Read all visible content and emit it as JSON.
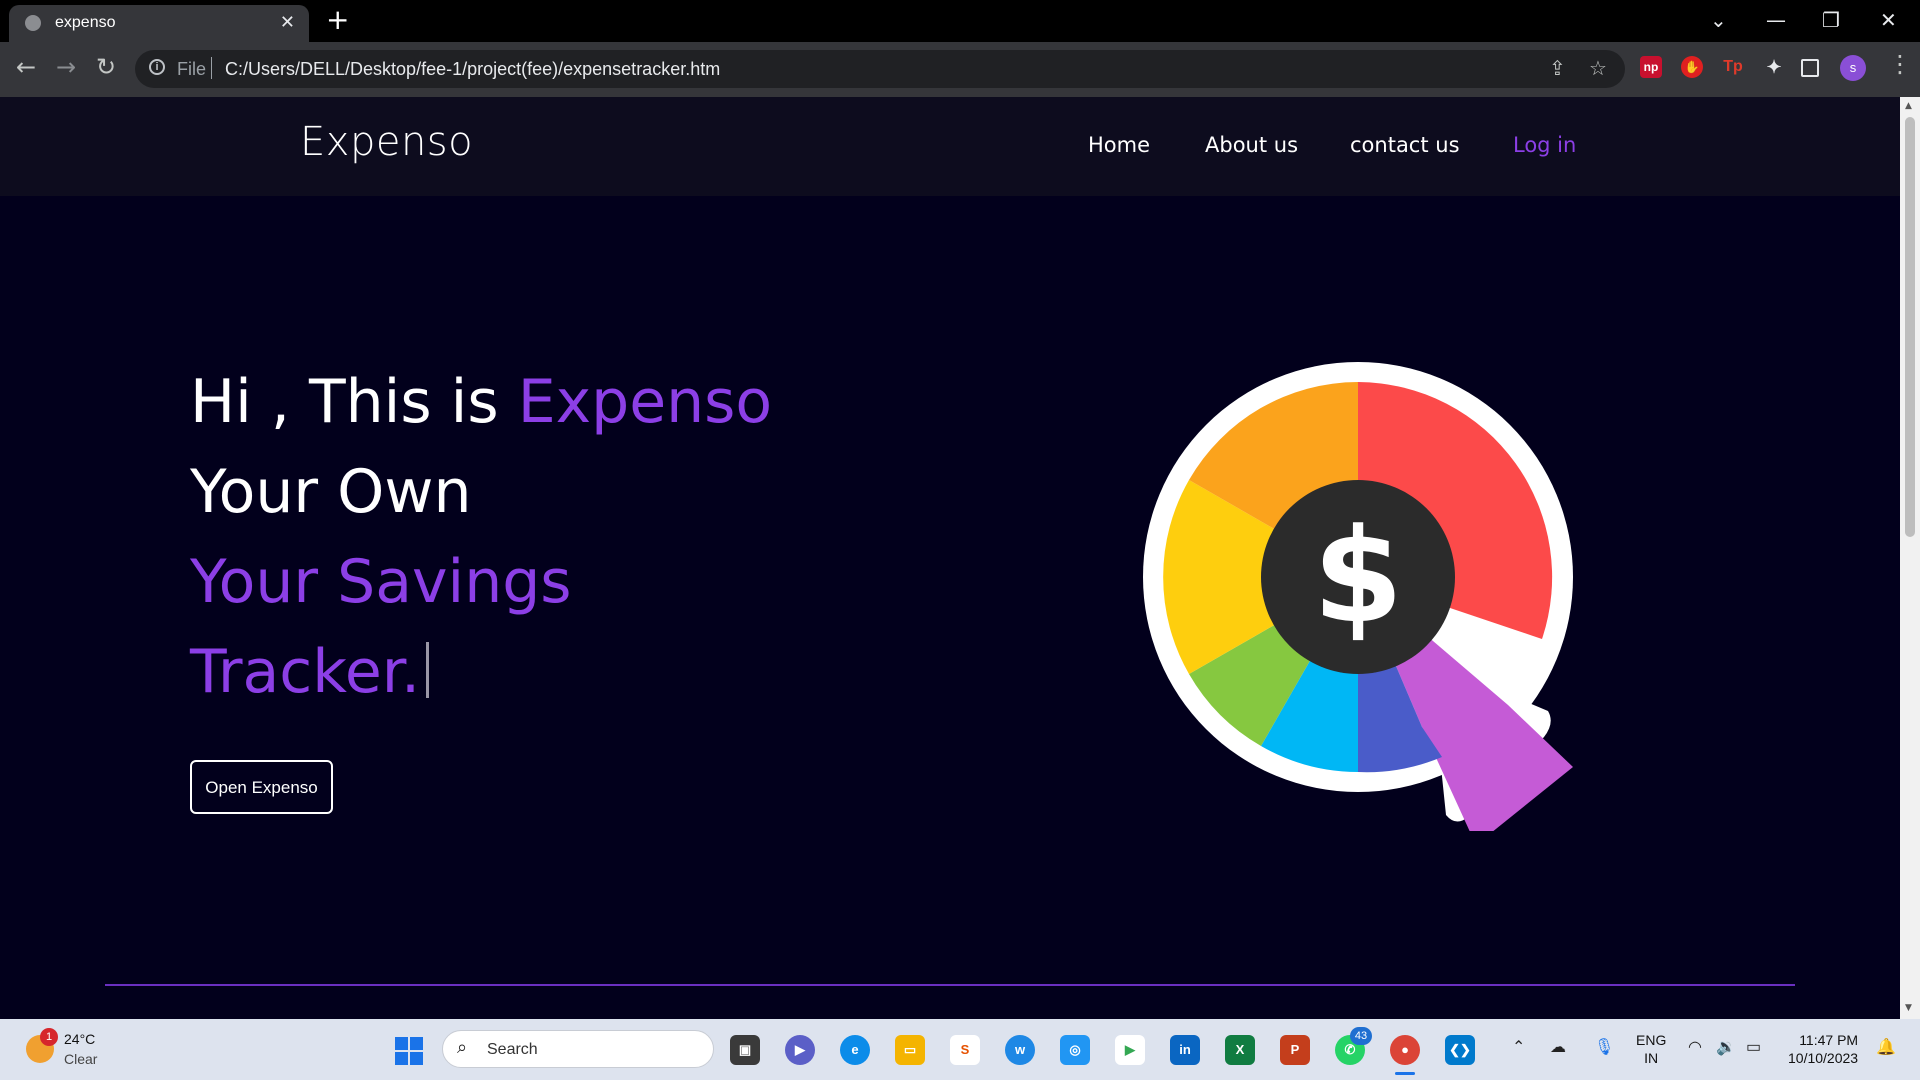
{
  "browser": {
    "tab_title": "expenso",
    "new_tab": "+",
    "url_scheme": "File",
    "url": "C:/Users/DELL/Desktop/fee-1/project(fee)/expensetracker.htm",
    "profile_initial": "s"
  },
  "site": {
    "brand": "Expenso",
    "nav": {
      "home": "Home",
      "about": "About us",
      "contact": "contact us",
      "login": "Log in"
    },
    "hero": {
      "line1_prefix": "Hi , This is ",
      "line1_accent": "Expenso",
      "line2": "Your Own",
      "line3": "Your Savings",
      "line4": "Tracker."
    },
    "cta": "Open Expenso",
    "logo_symbol": "$"
  },
  "taskbar": {
    "weather_alert": "1",
    "temperature": "24°C",
    "condition": "Clear",
    "search": "Search",
    "whatsapp_badge": "43",
    "lang_line1": "ENG",
    "lang_line2": "IN",
    "time": "11:47 PM",
    "date": "10/10/2023"
  },
  "colors": {
    "accent": "#8c3fe6",
    "page_bg": "#02001c",
    "nav_bg": "#0d0c1e",
    "pie": [
      "#fc4a4a",
      "#c55bd6",
      "#4a5cc9",
      "#00b7f5",
      "#86c840",
      "#fece0e",
      "#fba31c"
    ]
  },
  "icons": [
    "globe-icon",
    "close-icon",
    "back-icon",
    "forward-icon",
    "reload-icon",
    "info-icon",
    "share-icon",
    "star-icon",
    "extensions-icon",
    "sidepanel-icon",
    "menu-icon",
    "dollar-pie-logo",
    "windows-icon",
    "search-icon",
    "wifi-icon",
    "volume-icon",
    "battery-icon",
    "notification-icon"
  ]
}
